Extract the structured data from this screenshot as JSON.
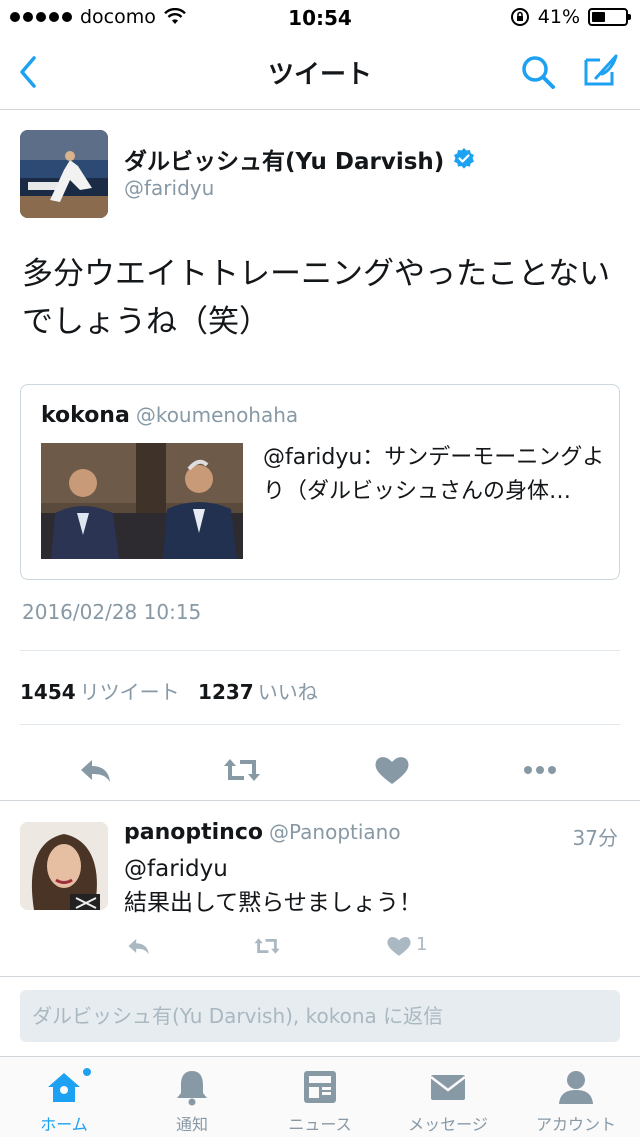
{
  "status_bar": {
    "carrier": "docomo",
    "time": "10:54",
    "battery_percent": "41%",
    "battery_level": 0.41
  },
  "nav": {
    "title": "ツイート",
    "accent_color": "#1da1f2"
  },
  "tweet": {
    "user_name": "ダルビッシュ有(Yu Darvish)",
    "handle": "@faridyu",
    "verified_icon": "verified-badge-icon",
    "text": "多分ウエイトトレーニングやったことないでしょうね（笑）",
    "quote": {
      "name": "kokona",
      "handle": "@koumenohaha",
      "text": "@faridyu：サンデーモーニングより（ダルビッシュさんの身体…"
    },
    "timestamp": "2016/02/28 10:15",
    "retweet_count": "1454",
    "retweet_label": "リツイート",
    "like_count": "1237",
    "like_label": "いいね"
  },
  "reply": {
    "name": "panoptinco",
    "handle": "@Panoptiano",
    "time": "37分",
    "mention": "@faridyu",
    "text": "結果出して黙らせましょう！",
    "like_count": "1"
  },
  "reply_box": {
    "placeholder": "ダルビッシュ有(Yu Darvish), kokona に返信"
  },
  "tabbar": {
    "items": [
      {
        "label": "ホーム",
        "icon": "home-icon",
        "active": true
      },
      {
        "label": "通知",
        "icon": "bell-icon"
      },
      {
        "label": "ニュース",
        "icon": "news-icon"
      },
      {
        "label": "メッセージ",
        "icon": "envelope-icon"
      },
      {
        "label": "アカウント",
        "icon": "person-icon"
      }
    ]
  }
}
